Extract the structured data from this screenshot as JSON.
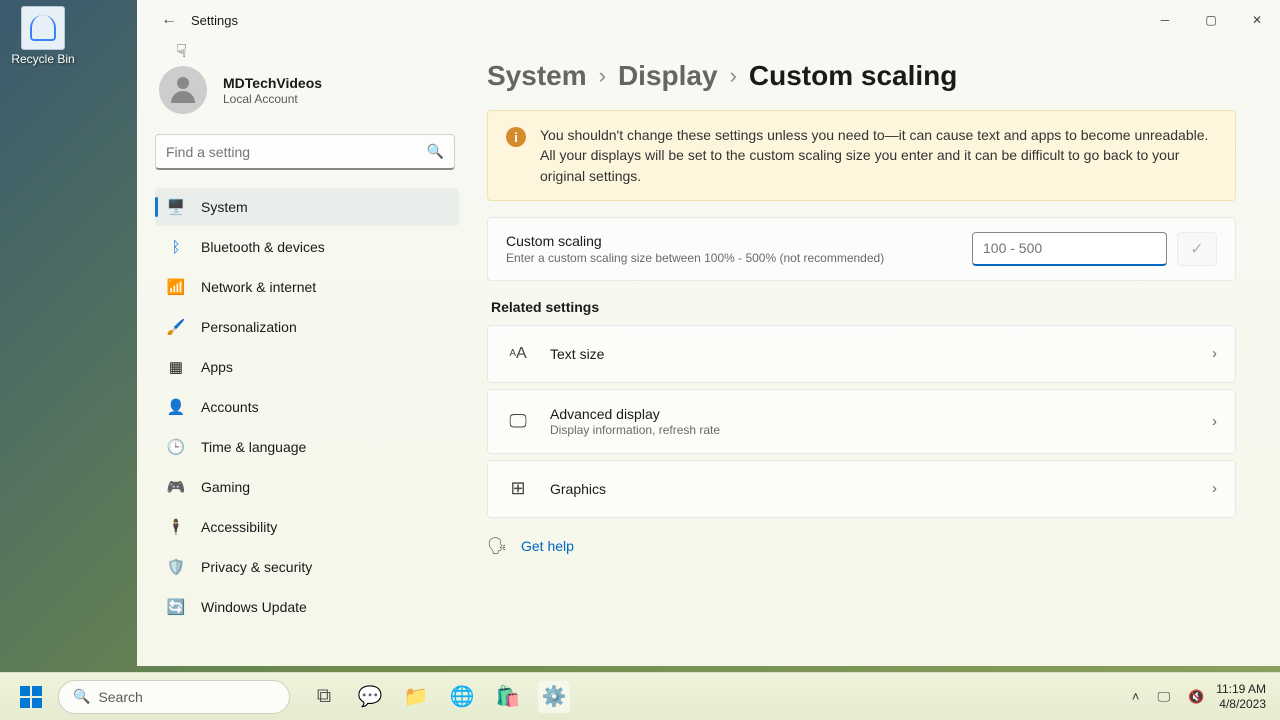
{
  "desktop": {
    "recycle_bin": "Recycle Bin"
  },
  "window": {
    "title": "Settings",
    "user_name": "MDTechVideos",
    "user_type": "Local Account",
    "search_placeholder": "Find a setting"
  },
  "sidebar": {
    "items": [
      {
        "label": "System",
        "active": true
      },
      {
        "label": "Bluetooth & devices"
      },
      {
        "label": "Network & internet"
      },
      {
        "label": "Personalization"
      },
      {
        "label": "Apps"
      },
      {
        "label": "Accounts"
      },
      {
        "label": "Time & language"
      },
      {
        "label": "Gaming"
      },
      {
        "label": "Accessibility"
      },
      {
        "label": "Privacy & security"
      },
      {
        "label": "Windows Update"
      }
    ]
  },
  "breadcrumb": {
    "a": "System",
    "b": "Display",
    "c": "Custom scaling"
  },
  "warning": "You shouldn't change these settings unless you need to—it can cause text and apps to become unreadable. All your displays will be set to the custom scaling size you enter and it can be difficult to go back to your original settings.",
  "scaling": {
    "title": "Custom scaling",
    "sub": "Enter a custom scaling size between 100% - 500% (not recommended)",
    "placeholder": "100 - 500"
  },
  "related": {
    "heading": "Related settings",
    "items": [
      {
        "title": "Text size",
        "sub": ""
      },
      {
        "title": "Advanced display",
        "sub": "Display information, refresh rate"
      },
      {
        "title": "Graphics",
        "sub": ""
      }
    ]
  },
  "help_link": "Get help",
  "taskbar": {
    "search": "Search",
    "time": "11:19 AM",
    "date": "4/8/2023"
  }
}
